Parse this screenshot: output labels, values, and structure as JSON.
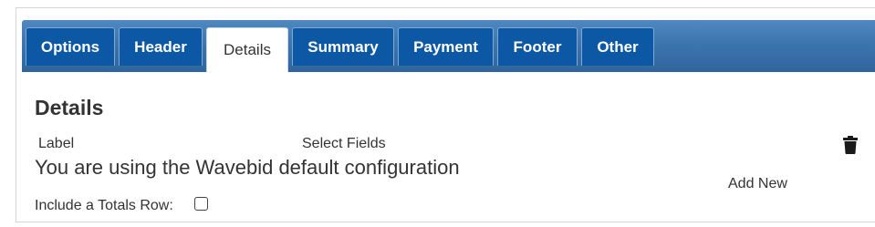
{
  "tabs": [
    {
      "label": "Options",
      "active": false
    },
    {
      "label": "Header",
      "active": false
    },
    {
      "label": "Details",
      "active": true
    },
    {
      "label": "Summary",
      "active": false
    },
    {
      "label": "Payment",
      "active": false
    },
    {
      "label": "Footer",
      "active": false
    },
    {
      "label": "Other",
      "active": false
    }
  ],
  "details": {
    "title": "Details",
    "col_label": "Label",
    "col_select_fields": "Select Fields",
    "message": "You are using the Wavebid default configuration",
    "add_new_label": "Add New",
    "delete_icon": "trash-icon",
    "totals_row_label": "Include a Totals Row:",
    "totals_row_checked": false
  },
  "colors": {
    "tab_bg": "#0d58a4",
    "tab_bar": "#3a72ab",
    "active_tab_bg": "#ffffff",
    "text": "#333333"
  }
}
